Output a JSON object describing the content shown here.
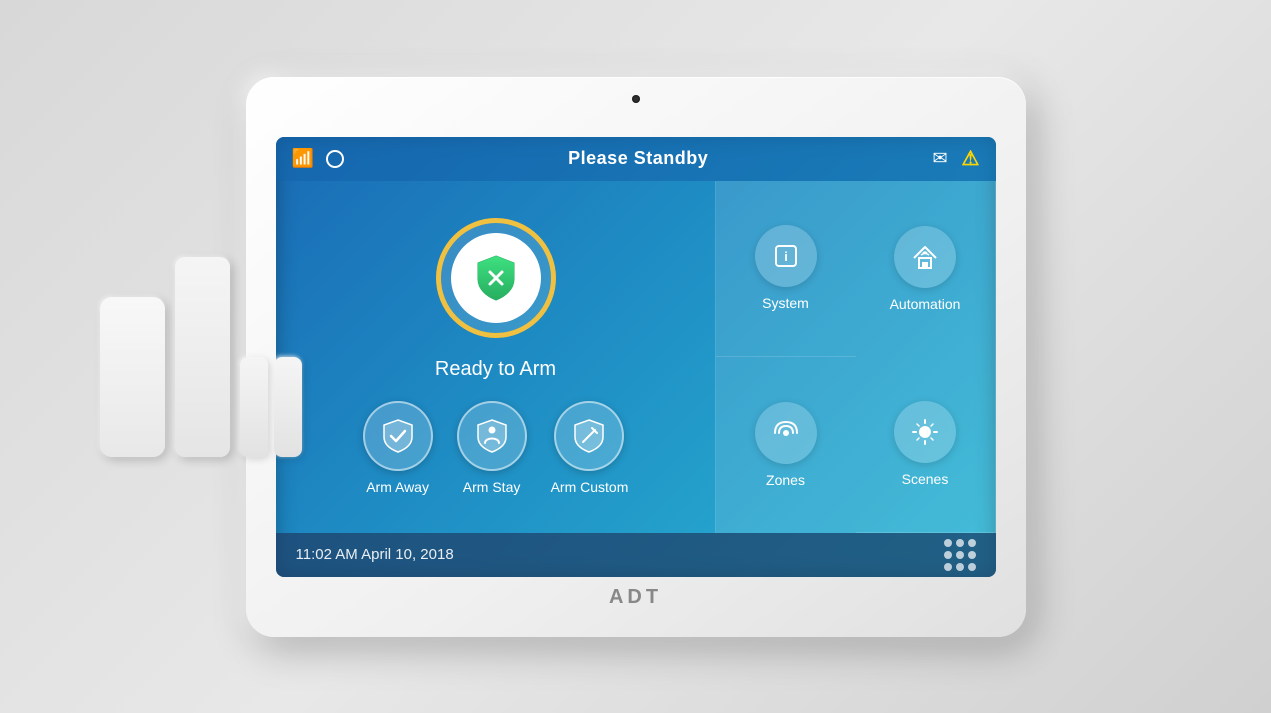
{
  "device": {
    "brand": "ADT"
  },
  "statusBar": {
    "title": "Please Standby"
  },
  "mainPanel": {
    "readyLabel": "Ready to Arm",
    "armButtons": [
      {
        "id": "arm-away",
        "label": "Arm Away"
      },
      {
        "id": "arm-stay",
        "label": "Arm Stay"
      },
      {
        "id": "arm-custom",
        "label": "Arm Custom"
      }
    ]
  },
  "rightPanel": {
    "buttons": [
      {
        "id": "system",
        "label": "System"
      },
      {
        "id": "automation",
        "label": "Automation"
      },
      {
        "id": "zones",
        "label": "Zones"
      },
      {
        "id": "scenes",
        "label": "Scenes"
      }
    ]
  },
  "bottomBar": {
    "datetime": "11:02 AM April 10, 2018"
  }
}
